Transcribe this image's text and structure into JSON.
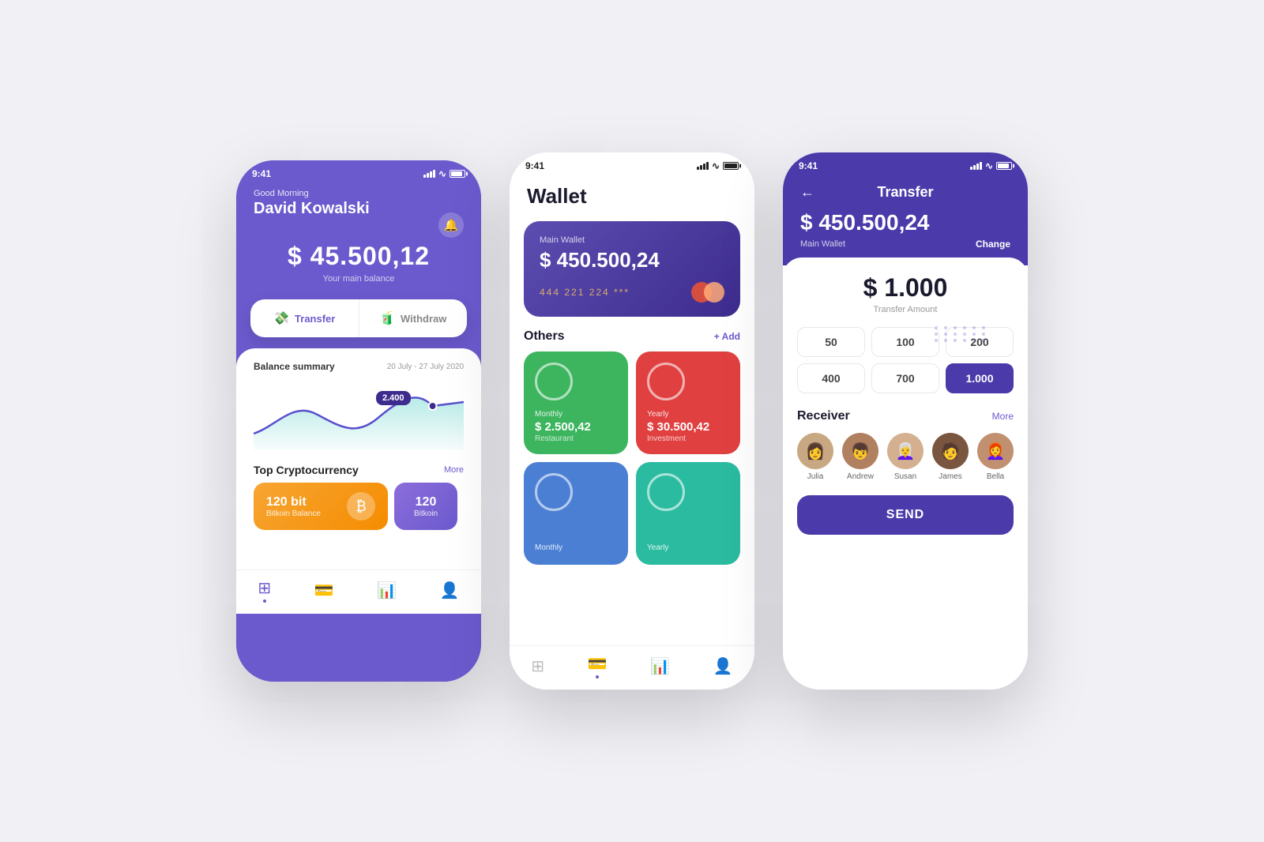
{
  "app": {
    "bg_color": "#f0f0f5",
    "accent": "#6b5acd",
    "accent2": "#4a3aaa"
  },
  "phone1": {
    "status_time": "9:41",
    "greeting": "Good Morning",
    "name": "David Kowalski",
    "balance": "$ 45.500,12",
    "balance_label": "Your main balance",
    "btn_transfer": "Transfer",
    "btn_withdraw": "Withdraw",
    "chart_title": "Balance summary",
    "chart_date": "20 July - 27 July 2020",
    "chart_tooltip": "2.400",
    "section_crypto": "Top Cryptocurrency",
    "crypto_more": "More",
    "crypto_amount": "120 bit",
    "crypto_label": "Bitkoin Balance",
    "crypto_amount2": "120",
    "crypto_label2": "Bitkoin"
  },
  "phone2": {
    "status_time": "9:41",
    "title": "Wallet",
    "card_label": "Main Wallet",
    "card_amount": "$ 450.500,24",
    "card_number": "444 221 224 ***",
    "others_title": "Others",
    "add_btn": "+ Add",
    "cards": [
      {
        "type": "Monthly",
        "amount": "$ 2.500,42",
        "name": "Restaurant",
        "color": "green"
      },
      {
        "type": "Yearly",
        "amount": "$ 30.500,42",
        "name": "Investment",
        "color": "red"
      },
      {
        "type": "Monthly",
        "amount": "",
        "name": "",
        "color": "blue"
      },
      {
        "type": "Yearly",
        "amount": "",
        "name": "",
        "color": "teal"
      }
    ]
  },
  "phone3": {
    "status_time": "9:41",
    "title": "Transfer",
    "balance": "$ 450.500,24",
    "balance_label": "Main Wallet",
    "change_btn": "Change",
    "transfer_amount": "$ 1.000",
    "transfer_label": "Transfer Amount",
    "presets": [
      "50",
      "100",
      "200",
      "400",
      "700",
      "1.000"
    ],
    "active_preset": "1.000",
    "receiver_title": "Receiver",
    "more_btn": "More",
    "receivers": [
      {
        "name": "Julia",
        "emoji": "👩"
      },
      {
        "name": "Andrew",
        "emoji": "👦"
      },
      {
        "name": "Susan",
        "emoji": "👩‍🦳"
      },
      {
        "name": "James",
        "emoji": "🧑‍🦱"
      },
      {
        "name": "Bella",
        "emoji": "👩‍🦰"
      }
    ],
    "send_btn": "SEND"
  }
}
